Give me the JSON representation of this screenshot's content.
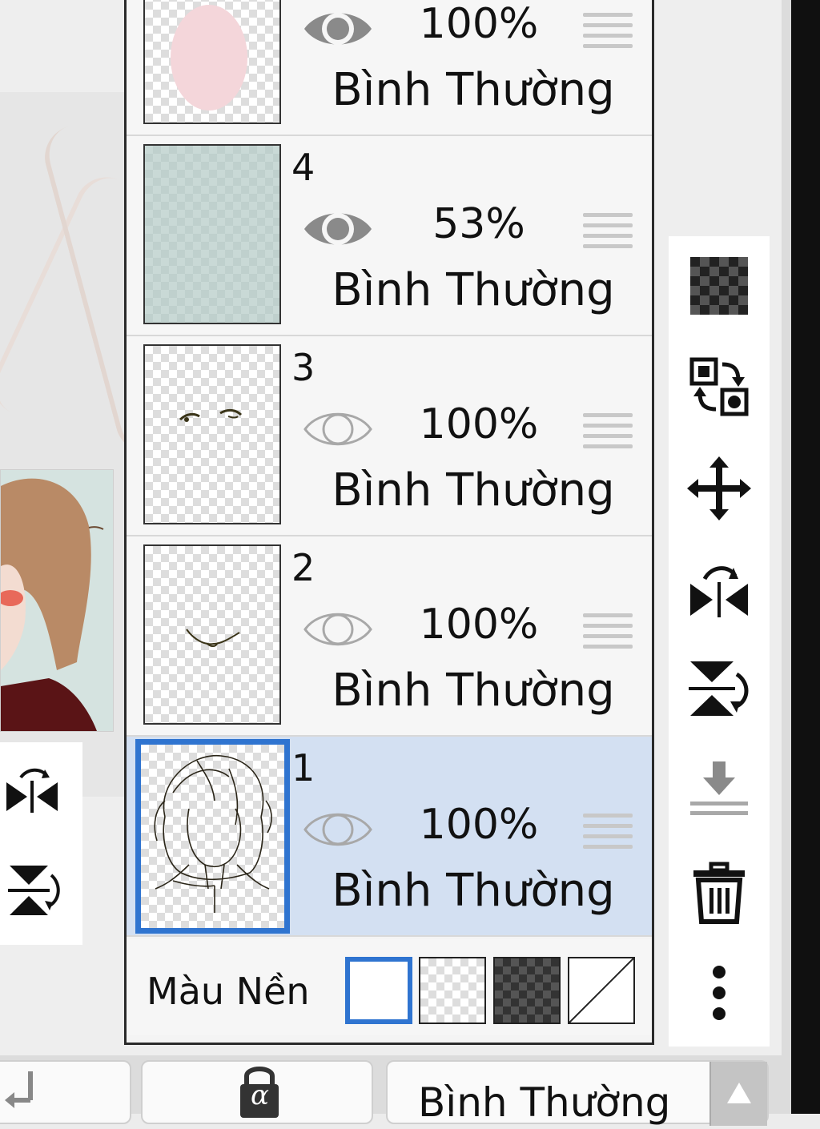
{
  "layers": [
    {
      "number": "",
      "opacity": "100%",
      "blend": "Bình Thường",
      "visible": true,
      "thumb_content": "pink-shape"
    },
    {
      "number": "4",
      "opacity": "53%",
      "blend": "Bình Thường",
      "visible": true,
      "thumb_content": "teal-fill"
    },
    {
      "number": "3",
      "opacity": "100%",
      "blend": "Bình Thường",
      "visible": false,
      "thumb_content": "eyes-sketch"
    },
    {
      "number": "2",
      "opacity": "100%",
      "blend": "Bình Thường",
      "visible": false,
      "thumb_content": "mouth-sketch"
    },
    {
      "number": "1",
      "opacity": "100%",
      "blend": "Bình Thường",
      "visible": false,
      "selected": true,
      "thumb_content": "hair-lineart"
    }
  ],
  "background": {
    "label": "Màu Nền",
    "options": [
      "white",
      "checker",
      "dark-checker",
      "none"
    ],
    "selected": "white"
  },
  "right_toolbar": [
    "transparency-icon",
    "swap-layers-icon",
    "move-icon",
    "flip-horizontal-icon",
    "flip-vertical-icon",
    "merge-down-icon",
    "trash-icon",
    "more-icon"
  ],
  "bottom_bar": {
    "blend_mode": "Bình Thường",
    "alpha_lock_symbol": "α"
  },
  "colors": {
    "accent": "#2f74d0",
    "selected_row": "#d3e0f2",
    "eye_visible": "#8a8a8a",
    "eye_hidden": "#a8a8a8"
  }
}
